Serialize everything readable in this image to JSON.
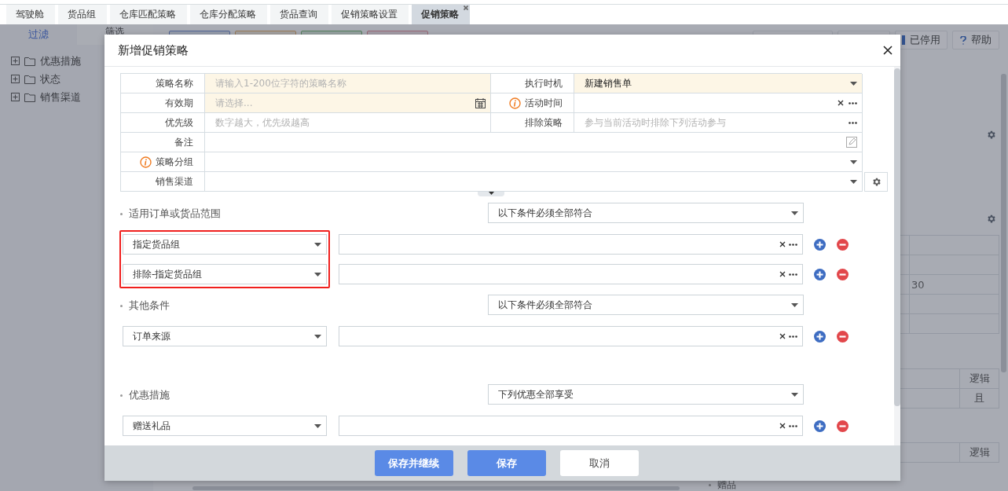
{
  "tabs": [
    {
      "label": "驾驶舱",
      "selected": false
    },
    {
      "label": "货品组",
      "selected": false
    },
    {
      "label": "仓库匹配策略",
      "selected": false
    },
    {
      "label": "仓库分配策略",
      "selected": false
    },
    {
      "label": "货品查询",
      "selected": false
    },
    {
      "label": "促销策略设置",
      "selected": false
    },
    {
      "label": "促销策略",
      "selected": true
    }
  ],
  "sidebar": {
    "tabs": [
      {
        "label": "过滤",
        "selected": true
      },
      {
        "label": "筛选",
        "selected": false
      }
    ],
    "tree": [
      {
        "label": "优惠措施",
        "expanded": false
      },
      {
        "label": "状态",
        "expanded": false
      },
      {
        "label": "销售渠道",
        "expanded": false
      }
    ]
  },
  "toolbar": {
    "buttons": [
      {
        "label": "已停用",
        "kind": "disabled"
      },
      {
        "label": "帮助",
        "kind": "help"
      }
    ]
  },
  "right_panel": {
    "table_1_cell": "30",
    "table_2": {
      "header": "逻辑",
      "cell": "且"
    },
    "table_3": {
      "header": "逻辑"
    },
    "list_item": "赠品"
  },
  "dialog": {
    "title": "新增促销策略",
    "fields": [
      {
        "label": "策略名称",
        "kind": "text",
        "placeholder": "请输入1-200位字符的策略名称",
        "required": true,
        "info": false
      },
      {
        "label": "执行时机",
        "kind": "select",
        "value": "新建销售单",
        "required": true,
        "info": false
      },
      {
        "label": "有效期",
        "kind": "date",
        "placeholder": "请选择...",
        "required": true,
        "info": false
      },
      {
        "label": "活动时间",
        "kind": "picker",
        "required": false,
        "info": true
      },
      {
        "label": "优先级",
        "kind": "text",
        "placeholder": "数字越大，优先级越高",
        "required": false,
        "info": false
      },
      {
        "label": "排除策略",
        "kind": "more",
        "placeholder": "参与当前活动时排除下列活动参与",
        "required": false,
        "info": false
      },
      {
        "label": "备注",
        "kind": "edit",
        "required": false,
        "info": false
      },
      {
        "label": "策略分组",
        "kind": "select",
        "required": false,
        "info": true
      },
      {
        "label": "销售渠道",
        "kind": "select",
        "required": false,
        "info": false
      }
    ],
    "sections": [
      {
        "title": "适用订单或货品范围",
        "mode": "以下条件必须全部符合",
        "conditions": [
          {
            "type": "指定货品组",
            "outlined": true
          },
          {
            "type": "排除-指定货品组",
            "outlined": true
          }
        ]
      },
      {
        "title": "其他条件",
        "mode": "以下条件必须全部符合",
        "conditions": [
          {
            "type": "订单来源",
            "outlined": false
          }
        ]
      },
      {
        "title": "优惠措施",
        "mode": "下列优惠全部享受",
        "conditions": [
          {
            "type": "赠送礼品",
            "outlined": false
          }
        ]
      }
    ],
    "buttons": [
      {
        "label": "保存并继续",
        "kind": "primary"
      },
      {
        "label": "保存",
        "kind": "primary"
      },
      {
        "label": "取消",
        "kind": "default"
      }
    ]
  }
}
